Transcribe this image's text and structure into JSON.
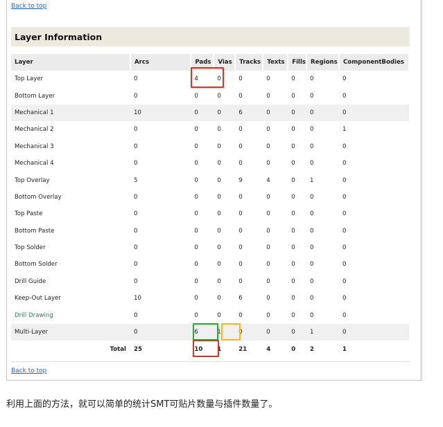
{
  "report": {
    "back_to_top_top": "Back to top",
    "back_to_top_bottom": "Back to top",
    "section_title": "Layer Information",
    "columns": [
      "Layer",
      "Arcs",
      "Pads",
      "Vias",
      "Tracks",
      "Texts",
      "Fills",
      "Regions",
      "ComponentBodies"
    ],
    "rows": [
      {
        "layer": "Top Layer",
        "arcs": "0",
        "pads": "4",
        "vias": "0",
        "tracks": "0",
        "texts": "0",
        "fills": "0",
        "regions": "0",
        "bodies": "0"
      },
      {
        "layer": "Bottom Layer",
        "arcs": "0",
        "pads": "0",
        "vias": "0",
        "tracks": "0",
        "texts": "0",
        "fills": "0",
        "regions": "0",
        "bodies": "0"
      },
      {
        "layer": "Mechanical 1",
        "arcs": "10",
        "pads": "0",
        "vias": "0",
        "tracks": "6",
        "texts": "0",
        "fills": "0",
        "regions": "0",
        "bodies": "0"
      },
      {
        "layer": "Mechanical 2",
        "arcs": "0",
        "pads": "0",
        "vias": "0",
        "tracks": "0",
        "texts": "0",
        "fills": "0",
        "regions": "0",
        "bodies": "1"
      },
      {
        "layer": "Mechanical 3",
        "arcs": "0",
        "pads": "0",
        "vias": "0",
        "tracks": "0",
        "texts": "0",
        "fills": "0",
        "regions": "0",
        "bodies": "0"
      },
      {
        "layer": "Mechanical 4",
        "arcs": "0",
        "pads": "0",
        "vias": "0",
        "tracks": "0",
        "texts": "0",
        "fills": "0",
        "regions": "0",
        "bodies": "0"
      },
      {
        "layer": "Top Overlay",
        "arcs": "5",
        "pads": "0",
        "vias": "0",
        "tracks": "9",
        "texts": "4",
        "fills": "0",
        "regions": "1",
        "bodies": "0"
      },
      {
        "layer": "Bottom Overlay",
        "arcs": "0",
        "pads": "0",
        "vias": "0",
        "tracks": "0",
        "texts": "0",
        "fills": "0",
        "regions": "0",
        "bodies": "0"
      },
      {
        "layer": "Top Paste",
        "arcs": "0",
        "pads": "0",
        "vias": "0",
        "tracks": "0",
        "texts": "0",
        "fills": "0",
        "regions": "0",
        "bodies": "0"
      },
      {
        "layer": "Bottom Paste",
        "arcs": "0",
        "pads": "0",
        "vias": "0",
        "tracks": "0",
        "texts": "0",
        "fills": "0",
        "regions": "0",
        "bodies": "0"
      },
      {
        "layer": "Top Solder",
        "arcs": "0",
        "pads": "0",
        "vias": "0",
        "tracks": "0",
        "texts": "0",
        "fills": "0",
        "regions": "0",
        "bodies": "0"
      },
      {
        "layer": "Bottom Solder",
        "arcs": "0",
        "pads": "0",
        "vias": "0",
        "tracks": "0",
        "texts": "0",
        "fills": "0",
        "regions": "0",
        "bodies": "0"
      },
      {
        "layer": "Drill Guide",
        "arcs": "0",
        "pads": "0",
        "vias": "0",
        "tracks": "0",
        "texts": "0",
        "fills": "0",
        "regions": "0",
        "bodies": "0"
      },
      {
        "layer": "Keep-Out Layer",
        "arcs": "10",
        "pads": "0",
        "vias": "0",
        "tracks": "6",
        "texts": "0",
        "fills": "0",
        "regions": "0",
        "bodies": "0"
      },
      {
        "layer": "Drill Drawing",
        "arcs": "0",
        "pads": "0",
        "vias": "0",
        "tracks": "0",
        "texts": "0",
        "fills": "0",
        "regions": "0",
        "bodies": "0"
      },
      {
        "layer": "Multi-Layer",
        "arcs": "0",
        "pads": "6",
        "vias": "1",
        "tracks": "0",
        "texts": "0",
        "fills": "0",
        "regions": "1",
        "bodies": "0"
      }
    ],
    "total": {
      "label": "Total",
      "arcs": "25",
      "pads": "10",
      "vias": "1",
      "tracks": "21",
      "texts": "4",
      "fills": "0",
      "regions": "2",
      "bodies": "1"
    }
  },
  "caption": "利用上面的方法，就可以简单的统计SMT可贴片数量与插件数量了。",
  "colors": {
    "link": "#2a64c8",
    "section_bg": "#ece9df",
    "header_bg": "#ecebeb",
    "box_red": "#e0302a",
    "box_green": "#2fa535",
    "box_orange": "#f5b621"
  }
}
